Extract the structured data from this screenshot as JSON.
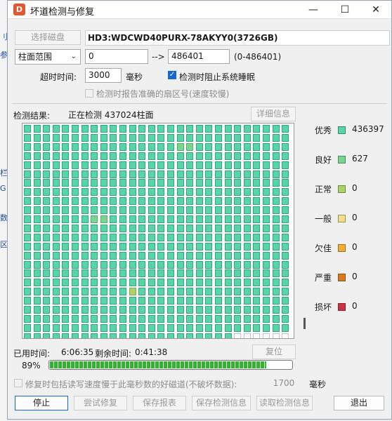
{
  "window": {
    "title": "坏道检测与修复",
    "app_icon": "D",
    "controls": {
      "minimize": "—",
      "maximize": "☐",
      "close": "✕"
    }
  },
  "disk": {
    "select_button": "选择磁盘",
    "name": "HD3:WDCWD40PURX-78AKYY0(3726GB)"
  },
  "range": {
    "mode": "柱面范围",
    "start": "0",
    "arrow": "-->",
    "end": "486401",
    "hint": "(0-486401)"
  },
  "timeout": {
    "label": "超时时间:",
    "value": "3000",
    "unit": "毫秒",
    "prevent_sleep_label": "检测时阻止系统睡眠",
    "prevent_sleep_checked": true
  },
  "report_sector": {
    "label": "检测时报告准确的扇区号(速度较慢)",
    "checked": false
  },
  "result": {
    "label": "检测结果:",
    "status": "正在检测 437024柱面",
    "details_button": "详细信息"
  },
  "legend": [
    {
      "label": "优秀",
      "color": "#55d7a5",
      "count": "436397"
    },
    {
      "label": "良好",
      "color": "#78d68e",
      "count": "627"
    },
    {
      "label": "正常",
      "color": "#a9d366",
      "count": "0"
    },
    {
      "label": "一般",
      "color": "#f3dd8a",
      "count": "0"
    },
    {
      "label": "欠佳",
      "color": "#f2ad3a",
      "count": "0"
    },
    {
      "label": "严重",
      "color": "#db7a1c",
      "count": "0"
    },
    {
      "label": "损坏",
      "color": "#c9323e",
      "count": "0"
    }
  ],
  "time": {
    "elapsed_label": "已用时间:",
    "elapsed": "6:06:35",
    "remaining_label": "剩余时间:",
    "remaining": "0:41:38",
    "reset_button": "复位"
  },
  "progress": {
    "percent_text": "89%",
    "value": 0.89
  },
  "repair_option": {
    "label": "修复时包括读写速度慢于此毫秒数的好磁道(不破坏数据):",
    "value": "1700",
    "unit": "毫秒",
    "checked": false
  },
  "buttons": {
    "stop": "停止",
    "try_repair": "尝试修复",
    "save_report": "保存报表",
    "save_detect": "保存检测信息",
    "read_detect": "读取检测信息",
    "exit": "退出"
  },
  "desktop_glyphs": [
    "刂",
    "参",
    "栏",
    "G",
    "数",
    "区"
  ]
}
